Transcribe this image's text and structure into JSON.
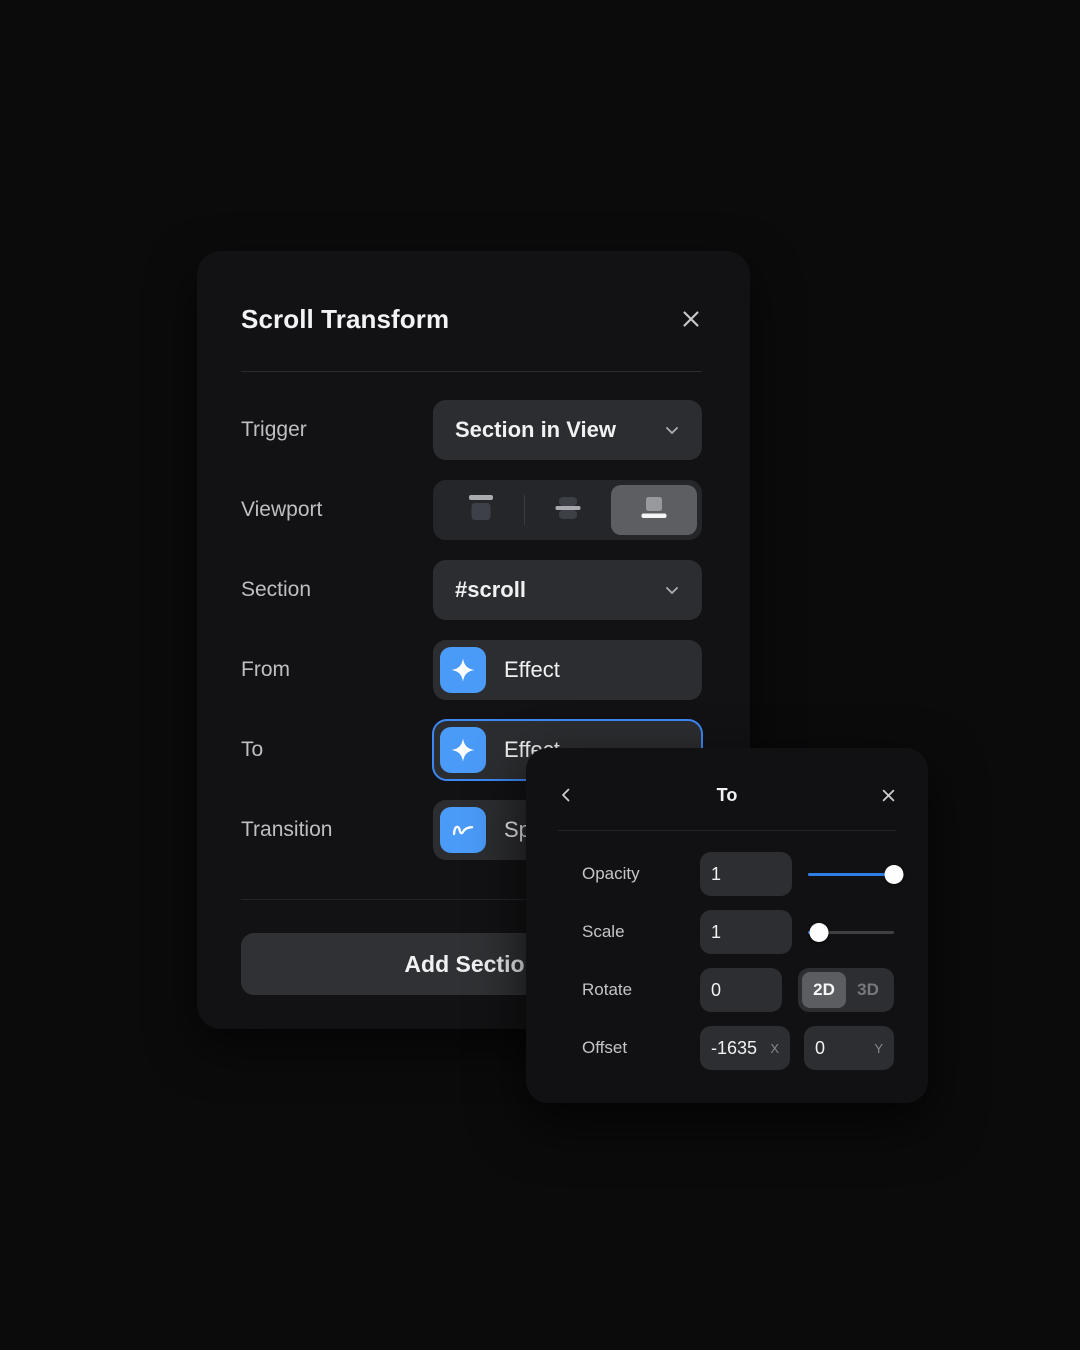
{
  "theme": {
    "background": "#0b0b0c",
    "panel_bg": "#121214",
    "popover_bg": "#111113",
    "field_bg": "#2c2d30",
    "accent": "#4a9bf7",
    "slider_fill": "#2f7ee6",
    "focus_border": "#3b88f5",
    "text_primary": "#f0f1f2",
    "text_secondary": "#bdbfc3",
    "text_muted": "#76787c"
  },
  "scroll_transform_panel": {
    "title": "Scroll Transform",
    "close_icon": "close-icon",
    "rows": {
      "trigger": {
        "label": "Trigger",
        "value": "Section in View",
        "chevron_icon": "chevron-down-icon"
      },
      "viewport": {
        "label": "Viewport",
        "options": [
          {
            "name": "desktop",
            "icon": "viewport-top-icon",
            "selected": false
          },
          {
            "name": "tablet",
            "icon": "viewport-middle-icon",
            "selected": false
          },
          {
            "name": "mobile",
            "icon": "viewport-bottom-icon",
            "selected": true
          }
        ]
      },
      "section": {
        "label": "Section",
        "value": "#scroll",
        "chevron_icon": "chevron-down-icon"
      },
      "from": {
        "label": "From",
        "value": "Effect",
        "icon": "sparkle-icon",
        "focused": false
      },
      "to": {
        "label": "To",
        "value": "Effect",
        "icon": "sparkle-icon",
        "focused": true
      },
      "transition": {
        "label": "Transition",
        "value": "Spring",
        "icon": "spring-curve-icon",
        "focused": false
      }
    },
    "add_section_label": "Add Section"
  },
  "to_popover": {
    "title": "To",
    "back_icon": "chevron-left-icon",
    "close_icon": "close-icon",
    "opacity": {
      "label": "Opacity",
      "value": "1",
      "slider_percent": 100
    },
    "scale": {
      "label": "Scale",
      "value": "1",
      "slider_percent": 13
    },
    "rotate": {
      "label": "Rotate",
      "value": "0",
      "dimension_options": [
        {
          "label": "2D",
          "selected": true
        },
        {
          "label": "3D",
          "selected": false
        }
      ]
    },
    "offset": {
      "label": "Offset",
      "x_value": "-1635",
      "x_unit": "X",
      "y_value": "0",
      "y_unit": "Y"
    }
  }
}
